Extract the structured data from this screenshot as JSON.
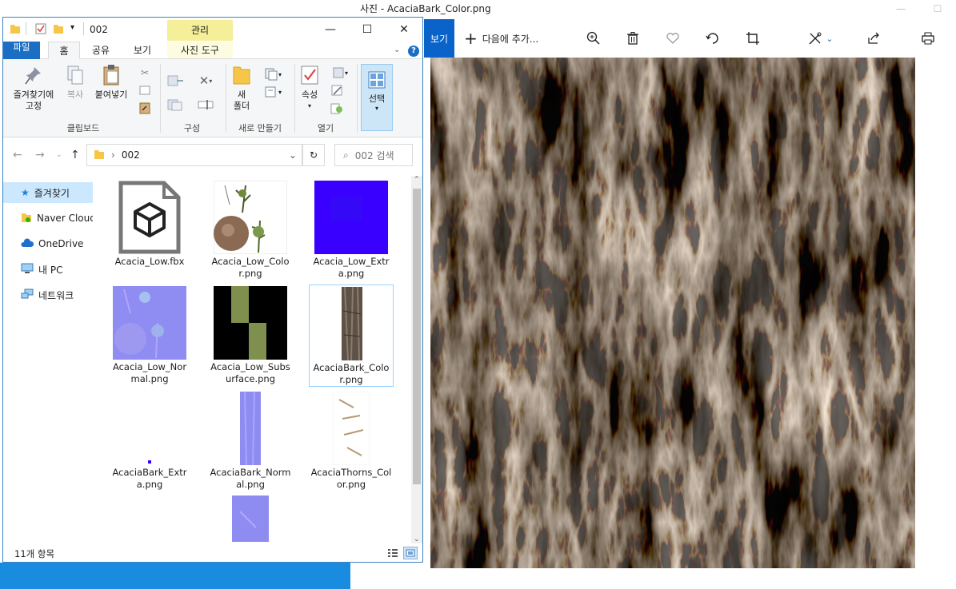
{
  "photos": {
    "title": "사진 - AcaciaBark_Color.png",
    "view_label": "보기",
    "add_label": "다음에 추가...",
    "icons": [
      "zoom-in-icon",
      "delete-icon",
      "heart-icon",
      "rotate-icon",
      "crop-icon",
      "edit-icon",
      "share-icon",
      "print-icon"
    ]
  },
  "explorer": {
    "title": "002",
    "manage_tab": "관리",
    "tabs": {
      "file": "파일",
      "home": "홈",
      "share": "공유",
      "view": "보기",
      "picture_tools": "사진 도구"
    },
    "ribbon": {
      "pin": "즐겨찾기에\n고정",
      "copy": "복사",
      "paste": "붙여넣기",
      "clipboard_group": "클립보드",
      "organize_group": "구성",
      "new_folder": "새\n폴더",
      "new_group": "새로 만들기",
      "properties": "속성",
      "open_group": "열기",
      "select": "선택"
    },
    "address": {
      "path": "002",
      "search_placeholder": "002 검색"
    },
    "nav": [
      {
        "label": "즐겨찾기",
        "icon": "star-icon"
      },
      {
        "label": "Naver Cloud",
        "icon": "cloud-folder-icon"
      },
      {
        "label": "OneDrive",
        "icon": "onedrive-icon"
      },
      {
        "label": "내 PC",
        "icon": "pc-icon"
      },
      {
        "label": "네트워크",
        "icon": "network-icon"
      }
    ],
    "files": [
      {
        "name": "Acacia_Low.fbx"
      },
      {
        "name": "Acacia_Low_Color.png"
      },
      {
        "name": "Acacia_Low_Extra.png"
      },
      {
        "name": "Acacia_Low_Normal.png"
      },
      {
        "name": "Acacia_Low_Subsurface.png"
      },
      {
        "name": "AcaciaBark_Color.png"
      },
      {
        "name": "AcaciaBark_Extra.png"
      },
      {
        "name": "AcaciaBark_Normal.png"
      },
      {
        "name": "AcaciaThorns_Color.png"
      },
      {
        "name": ""
      }
    ],
    "status": "11개 항목"
  }
}
